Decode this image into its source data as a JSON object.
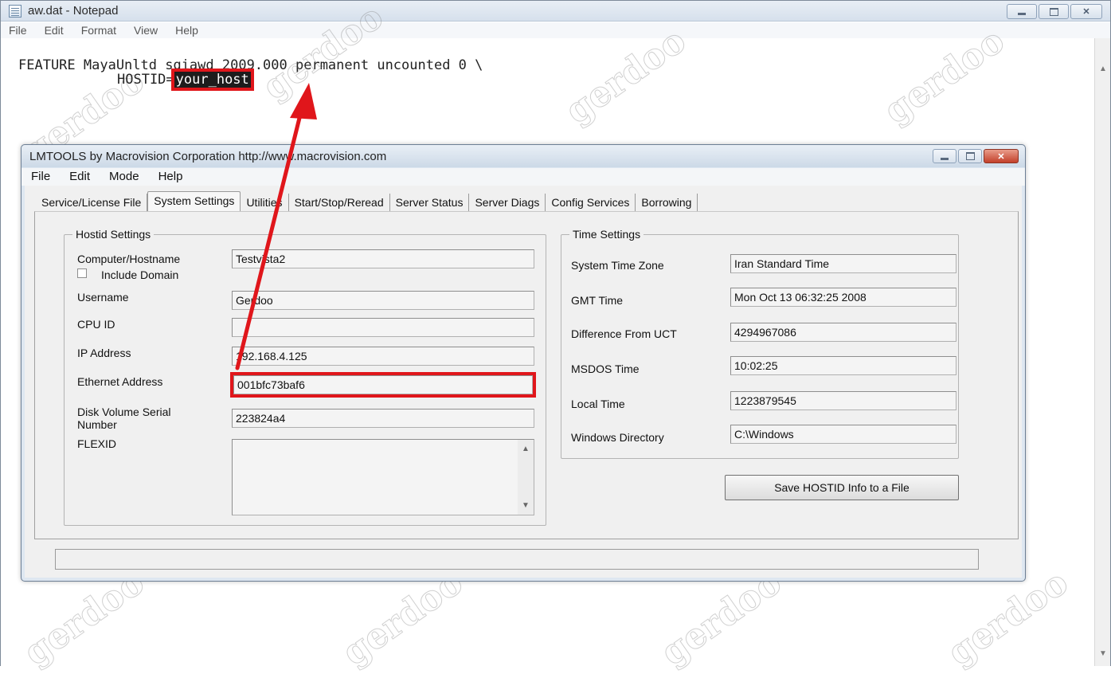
{
  "notepad": {
    "title": "aw.dat - Notepad",
    "menu": [
      "File",
      "Edit",
      "Format",
      "View",
      "Help"
    ],
    "line1": "FEATURE MayaUnltd sgiawd 2009.000 permanent uncounted 0 \\",
    "line2_prefix": "HOSTID=",
    "hostid_value": "your_host"
  },
  "lmtools": {
    "title": "LMTOOLS by Macrovision Corporation http://www.macrovision.com",
    "menu": [
      "File",
      "Edit",
      "Mode",
      "Help"
    ],
    "tabs": [
      "Service/License File",
      "System Settings",
      "Utilities",
      "Start/Stop/Reread",
      "Server Status",
      "Server Diags",
      "Config Services",
      "Borrowing"
    ],
    "active_tab": "System Settings",
    "hostid_settings": {
      "title": "Hostid Settings",
      "computer_hostname_label": "Computer/Hostname",
      "computer_hostname": "Testvista2",
      "include_domain_label": "Include Domain",
      "username_label": "Username",
      "username": "Gerdoo",
      "cpu_id_label": "CPU ID",
      "cpu_id": "",
      "ip_address_label": "IP Address",
      "ip_address": "192.168.4.125",
      "ethernet_address_label": "Ethernet Address",
      "ethernet_address": "001bfc73baf6",
      "disk_volume_label_1": "Disk Volume Serial",
      "disk_volume_label_2": "Number",
      "disk_volume": "223824a4",
      "flexid_label": "FLEXID"
    },
    "time_settings": {
      "title": "Time Settings",
      "time_zone_label": "System Time Zone",
      "time_zone": "Iran Standard Time",
      "gmt_time_label": "GMT Time",
      "gmt_time": "Mon Oct 13 06:32:25 2008",
      "diff_label": "Difference From UCT",
      "diff": "4294967086",
      "msdos_label": "MSDOS Time",
      "msdos": "10:02:25",
      "local_label": "Local Time",
      "local": "1223879545",
      "windir_label": "Windows Directory",
      "windir": "C:\\Windows"
    },
    "save_button": "Save HOSTID Info to a File",
    "status_text": ""
  },
  "colors": {
    "annotation_red": "#e0161b"
  }
}
